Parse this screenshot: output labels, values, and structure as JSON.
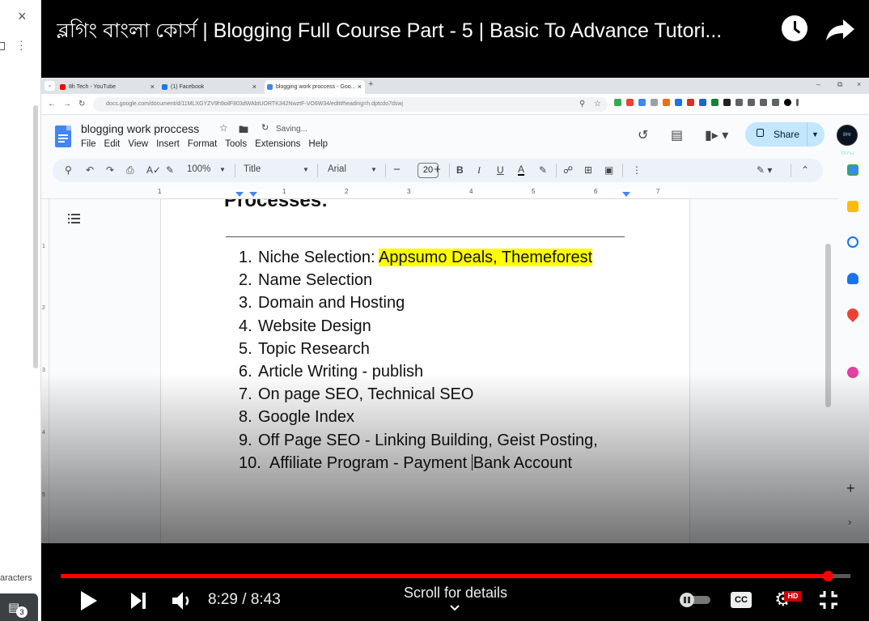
{
  "video": {
    "title": "ব্লগিং বাংলা কোর্স | Blogging Full Course Part - 5 | Basic To Advance Tutori...",
    "current_time": "8:29",
    "duration": "8:43",
    "time_display": "8:29 / 8:43",
    "progress_percent": 97.1,
    "scroll_hint": "Scroll for details",
    "hd_badge": "HD",
    "cc_label": "CC",
    "icons": [
      "watch-later-icon",
      "share-icon",
      "play-icon",
      "next-icon",
      "volume-icon",
      "autoplay-toggle-icon",
      "captions-icon",
      "settings-icon",
      "exit-fullscreen-icon",
      "chevron-down-icon"
    ],
    "accent_color": "#ff0000"
  },
  "outer_page": {
    "close_glyph": "×",
    "characters_text": "aracters",
    "chat_count": "3"
  },
  "browser": {
    "tabs": [
      {
        "label": "8h Tech - YouTube",
        "active": false
      },
      {
        "label": "(1) Facebook",
        "active": false
      },
      {
        "label": "blogging work proccess - Goo...",
        "active": true
      }
    ],
    "url": "docs.google.com/document/d/11MLXGYZV9h9oilF803dWAbtUORTK342NwztF-VO6W34/edit#heading=h.dptcdo7dswj"
  },
  "docs": {
    "doc_title": "blogging work proccess",
    "saving_status": "Saving...",
    "menus": [
      "File",
      "Edit",
      "View",
      "Insert",
      "Format",
      "Tools",
      "Extensions",
      "Help"
    ],
    "share_label": "Share",
    "avatar_text": "8Hr TECH",
    "toolbar": {
      "zoom": "100%",
      "style": "Title",
      "font": "Arial",
      "font_size": "20",
      "bold": "B",
      "italic": "I",
      "underline": "U",
      "text_color": "A"
    },
    "ruler_numbers": [
      "1",
      "1",
      "2",
      "3",
      "4",
      "5",
      "6",
      "7"
    ],
    "vruler_numbers": [
      "1",
      "2",
      "3",
      "4",
      "5"
    ],
    "page": {
      "heading": "Processes:",
      "items": [
        {
          "num": "1.",
          "text": "Niche Selection: ",
          "highlight": "Appsumo Deals, Themeforest"
        },
        {
          "num": "2.",
          "text": "Name Selection"
        },
        {
          "num": "3.",
          "text": "Domain and Hosting"
        },
        {
          "num": "4.",
          "text": "Website Design"
        },
        {
          "num": "5.",
          "text": "Topic Research"
        },
        {
          "num": "6.",
          "text": "Article Writing - publish"
        },
        {
          "num": "7.",
          "text": "On page SEO, Technical SEO"
        },
        {
          "num": "8.",
          "text": "Google Index"
        },
        {
          "num": "9.",
          "text": "Off Page SEO - Linking Building, Geist Posting,"
        },
        {
          "num": "10.",
          "text": "Affiliate Program - Payment ",
          "text_after_cursor": "Bank Account"
        }
      ],
      "highlight_color": "#ffff00"
    }
  }
}
